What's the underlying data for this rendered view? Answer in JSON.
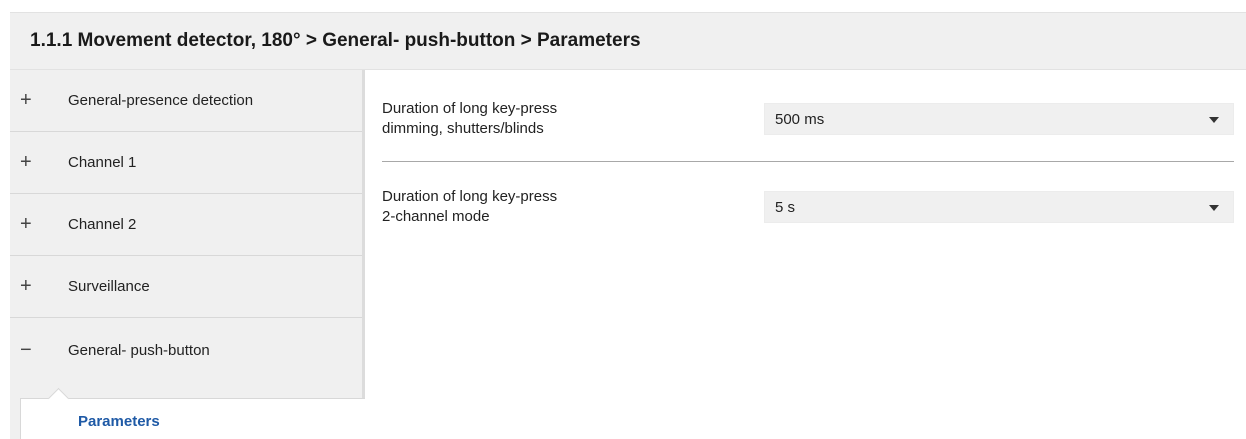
{
  "header": {
    "title": "1.1.1 Movement detector, 180° > General- push-button > Parameters"
  },
  "sidebar": {
    "items": [
      {
        "sign": "+",
        "label": "General-presence detection"
      },
      {
        "sign": "+",
        "label": "Channel 1"
      },
      {
        "sign": "+",
        "label": "Channel 2"
      },
      {
        "sign": "+",
        "label": "Surveillance"
      },
      {
        "sign": "−",
        "label": "General- push-button"
      }
    ],
    "subitem": {
      "label": "Parameters"
    }
  },
  "params": [
    {
      "label_line1": "Duration of long key-press",
      "label_line2": "dimming, shutters/blinds",
      "value": "500 ms"
    },
    {
      "label_line1": "Duration of long key-press",
      "label_line2": "2-channel mode",
      "value": "5 s"
    }
  ],
  "icons": {
    "expand": "plus-icon",
    "collapse": "minus-icon",
    "dropdown": "chevron-down-icon"
  }
}
